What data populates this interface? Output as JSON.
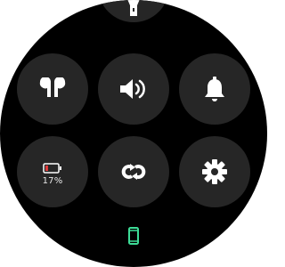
{
  "tiles": [
    {
      "id": "partial-top-left",
      "icon": "partial-circle-icon"
    },
    {
      "id": "flashlight",
      "icon": "flashlight-icon"
    },
    {
      "id": "brightness",
      "icon": "sun-icon"
    },
    {
      "id": "earbuds",
      "icon": "earbuds-icon"
    },
    {
      "id": "sound",
      "icon": "speaker-volume-icon"
    },
    {
      "id": "notifications",
      "icon": "bell-icon"
    },
    {
      "id": "battery",
      "icon": "battery-icon",
      "label": "17%"
    },
    {
      "id": "sync",
      "icon": "sync-icon"
    },
    {
      "id": "settings",
      "icon": "gear-icon"
    }
  ],
  "colors": {
    "background": "#000000",
    "tile": "#262626",
    "icon": "#ffffff",
    "accent": "#3ddc97",
    "battery_fill": "#e03b3b"
  },
  "page_indicator": {
    "icon": "phone-icon"
  }
}
